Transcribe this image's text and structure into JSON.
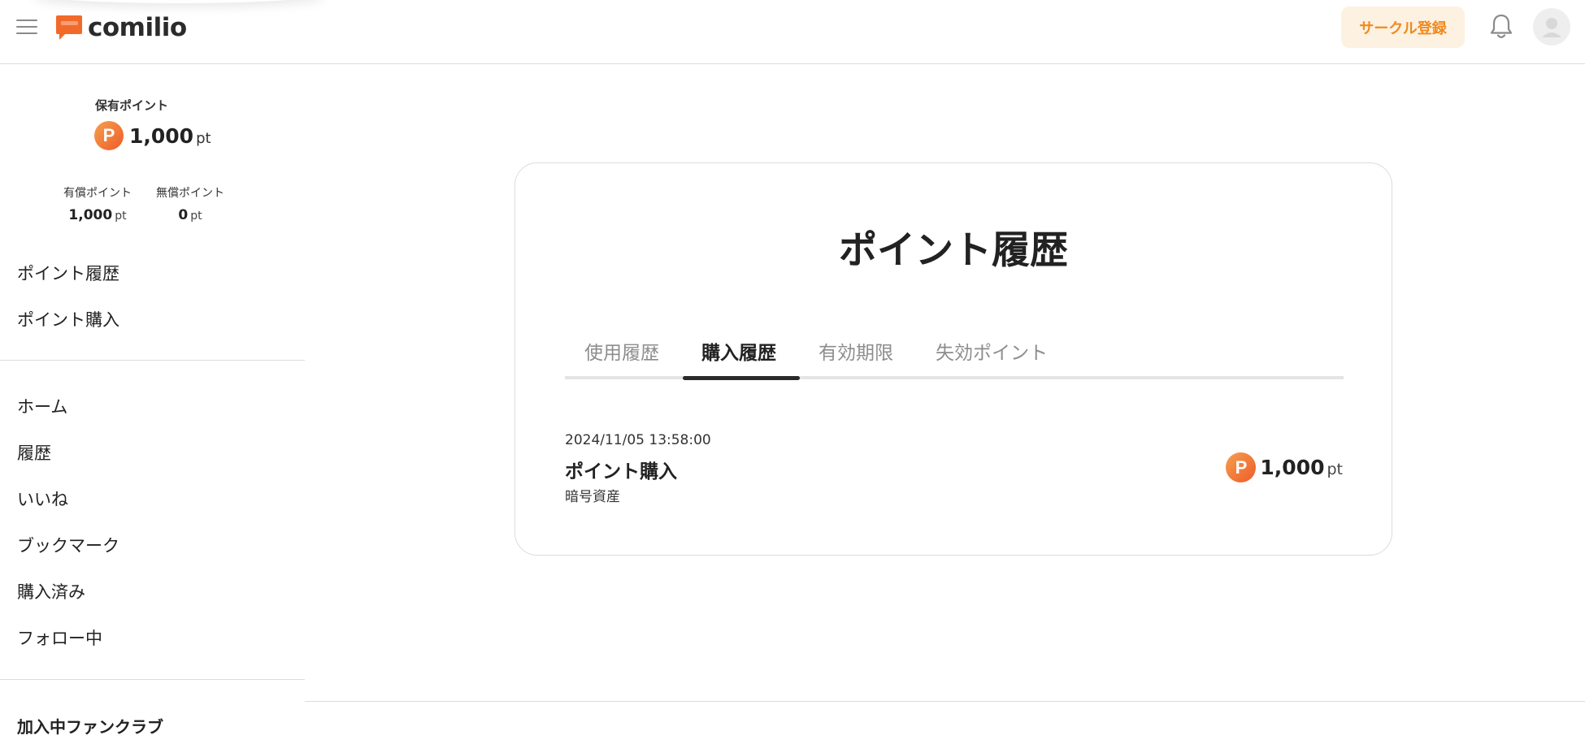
{
  "header": {
    "logo_text": "comilio",
    "circle_register_label": "サークル登録",
    "brand_color": "#f26a2a",
    "accent_bg": "#fdf1e2",
    "accent_text": "#f08a1d"
  },
  "sidebar": {
    "held_points_label": "保有ポイント",
    "held_points_badge": "P",
    "held_points_value": "1,000",
    "held_points_unit": "pt",
    "paid_points_label": "有償ポイント",
    "paid_points_value": "1,000",
    "paid_points_unit": "pt",
    "free_points_label": "無償ポイント",
    "free_points_value": "0",
    "free_points_unit": "pt",
    "point_links": [
      "ポイント履歴",
      "ポイント購入"
    ],
    "nav_items": [
      "ホーム",
      "履歴",
      "いいね",
      "ブックマーク",
      "購入済み",
      "フォロー中"
    ],
    "fanclub_heading": "加入中ファンクラブ"
  },
  "main": {
    "title": "ポイント履歴",
    "tabs": [
      {
        "label": "使用履歴",
        "active": false
      },
      {
        "label": "購入履歴",
        "active": true
      },
      {
        "label": "有効期限",
        "active": false
      },
      {
        "label": "失効ポイント",
        "active": false
      }
    ],
    "records": [
      {
        "datetime": "2024/11/05 13:58:00",
        "title": "ポイント購入",
        "method": "暗号資産",
        "badge": "P",
        "amount": "1,000",
        "unit": "pt"
      }
    ]
  },
  "icons": {
    "menu": "hamburger-menu-icon",
    "logo": "comilio-logo-icon",
    "notification": "bell-icon",
    "user": "user-avatar-icon",
    "point": "point-p-icon"
  }
}
